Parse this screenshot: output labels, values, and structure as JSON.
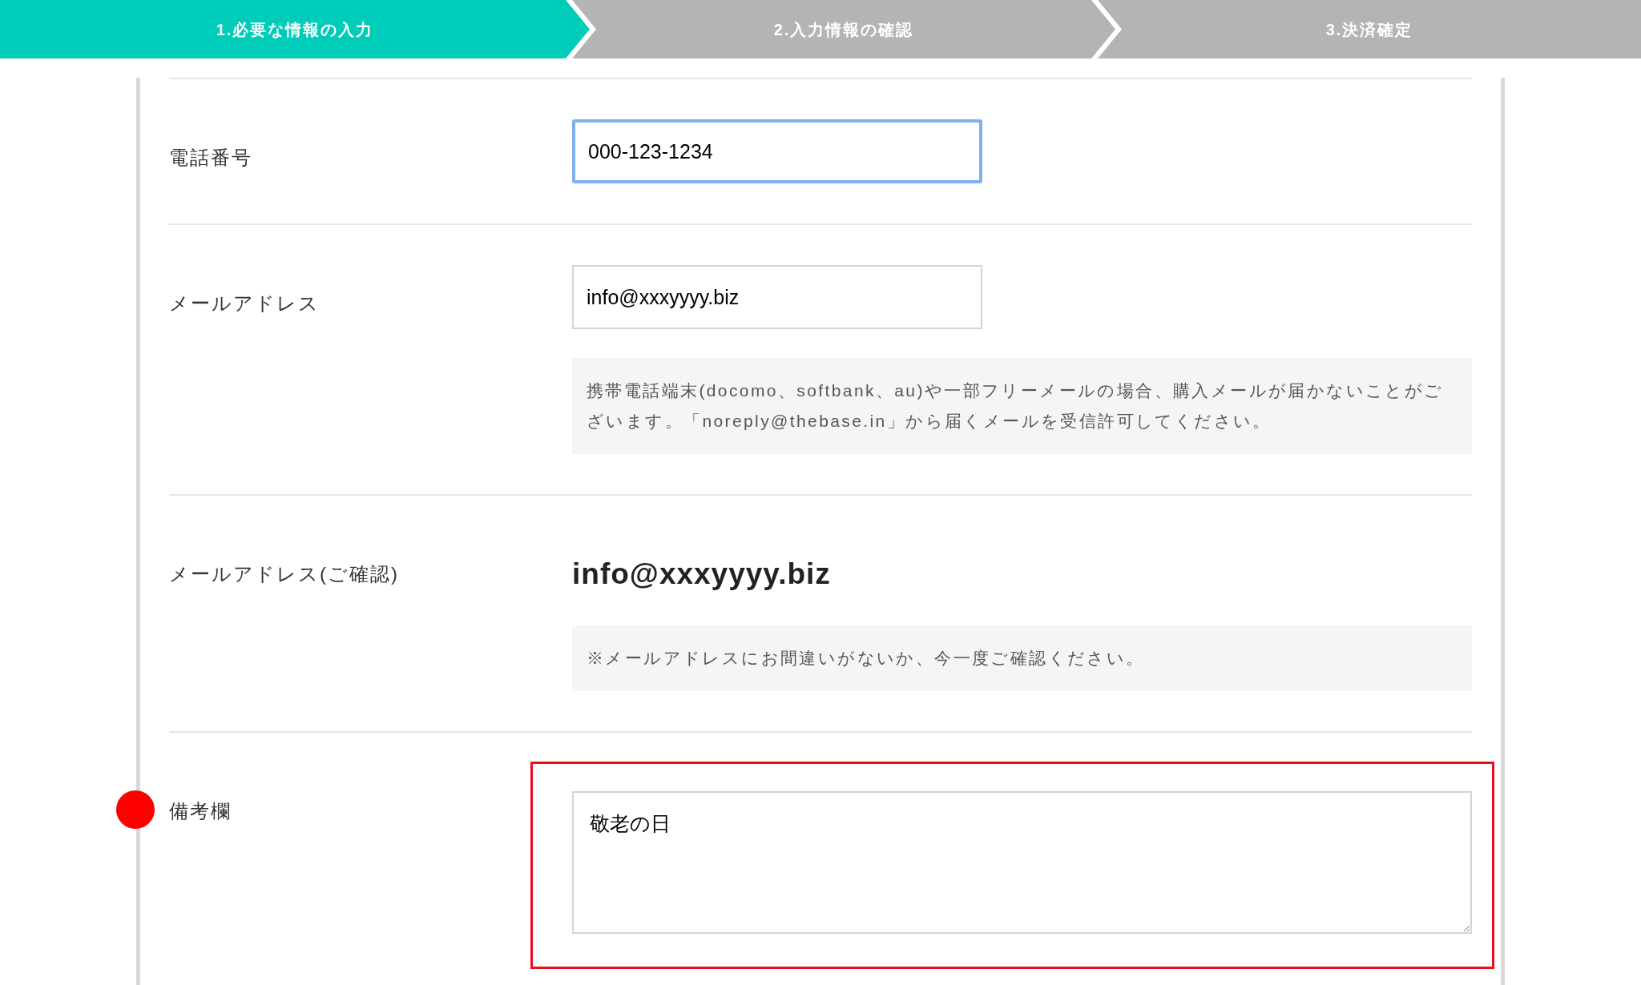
{
  "steps": [
    {
      "label": "1.必要な情報の入力",
      "selected": true
    },
    {
      "label": "2.入力情報の確認",
      "selected": false
    },
    {
      "label": "3.決済確定",
      "selected": false
    }
  ],
  "rows": [
    {
      "kind": "input",
      "label": "電話番号",
      "value": "000-123-1234",
      "focused": true,
      "highlighted": false
    },
    {
      "kind": "input",
      "label": "メールアドレス",
      "value": "info@xxxyyyy.biz",
      "focused": false,
      "highlighted": false,
      "note": "携帯電話端末(docomo、softbank、au)や一部フリーメールの場合、購入メールが届かないことがございます。「noreply@thebase.in」から届くメールを受信許可してください。"
    },
    {
      "kind": "text",
      "label": "メールアドレス(ご確認)",
      "value": "info@xxxyyyy.biz",
      "highlighted": false,
      "note": "※メールアドレスにお間違いがないか、今一度ご確認ください。"
    },
    {
      "kind": "textarea",
      "label": "備考欄",
      "value": "敬老の日",
      "focused": false,
      "highlighted": true
    }
  ]
}
